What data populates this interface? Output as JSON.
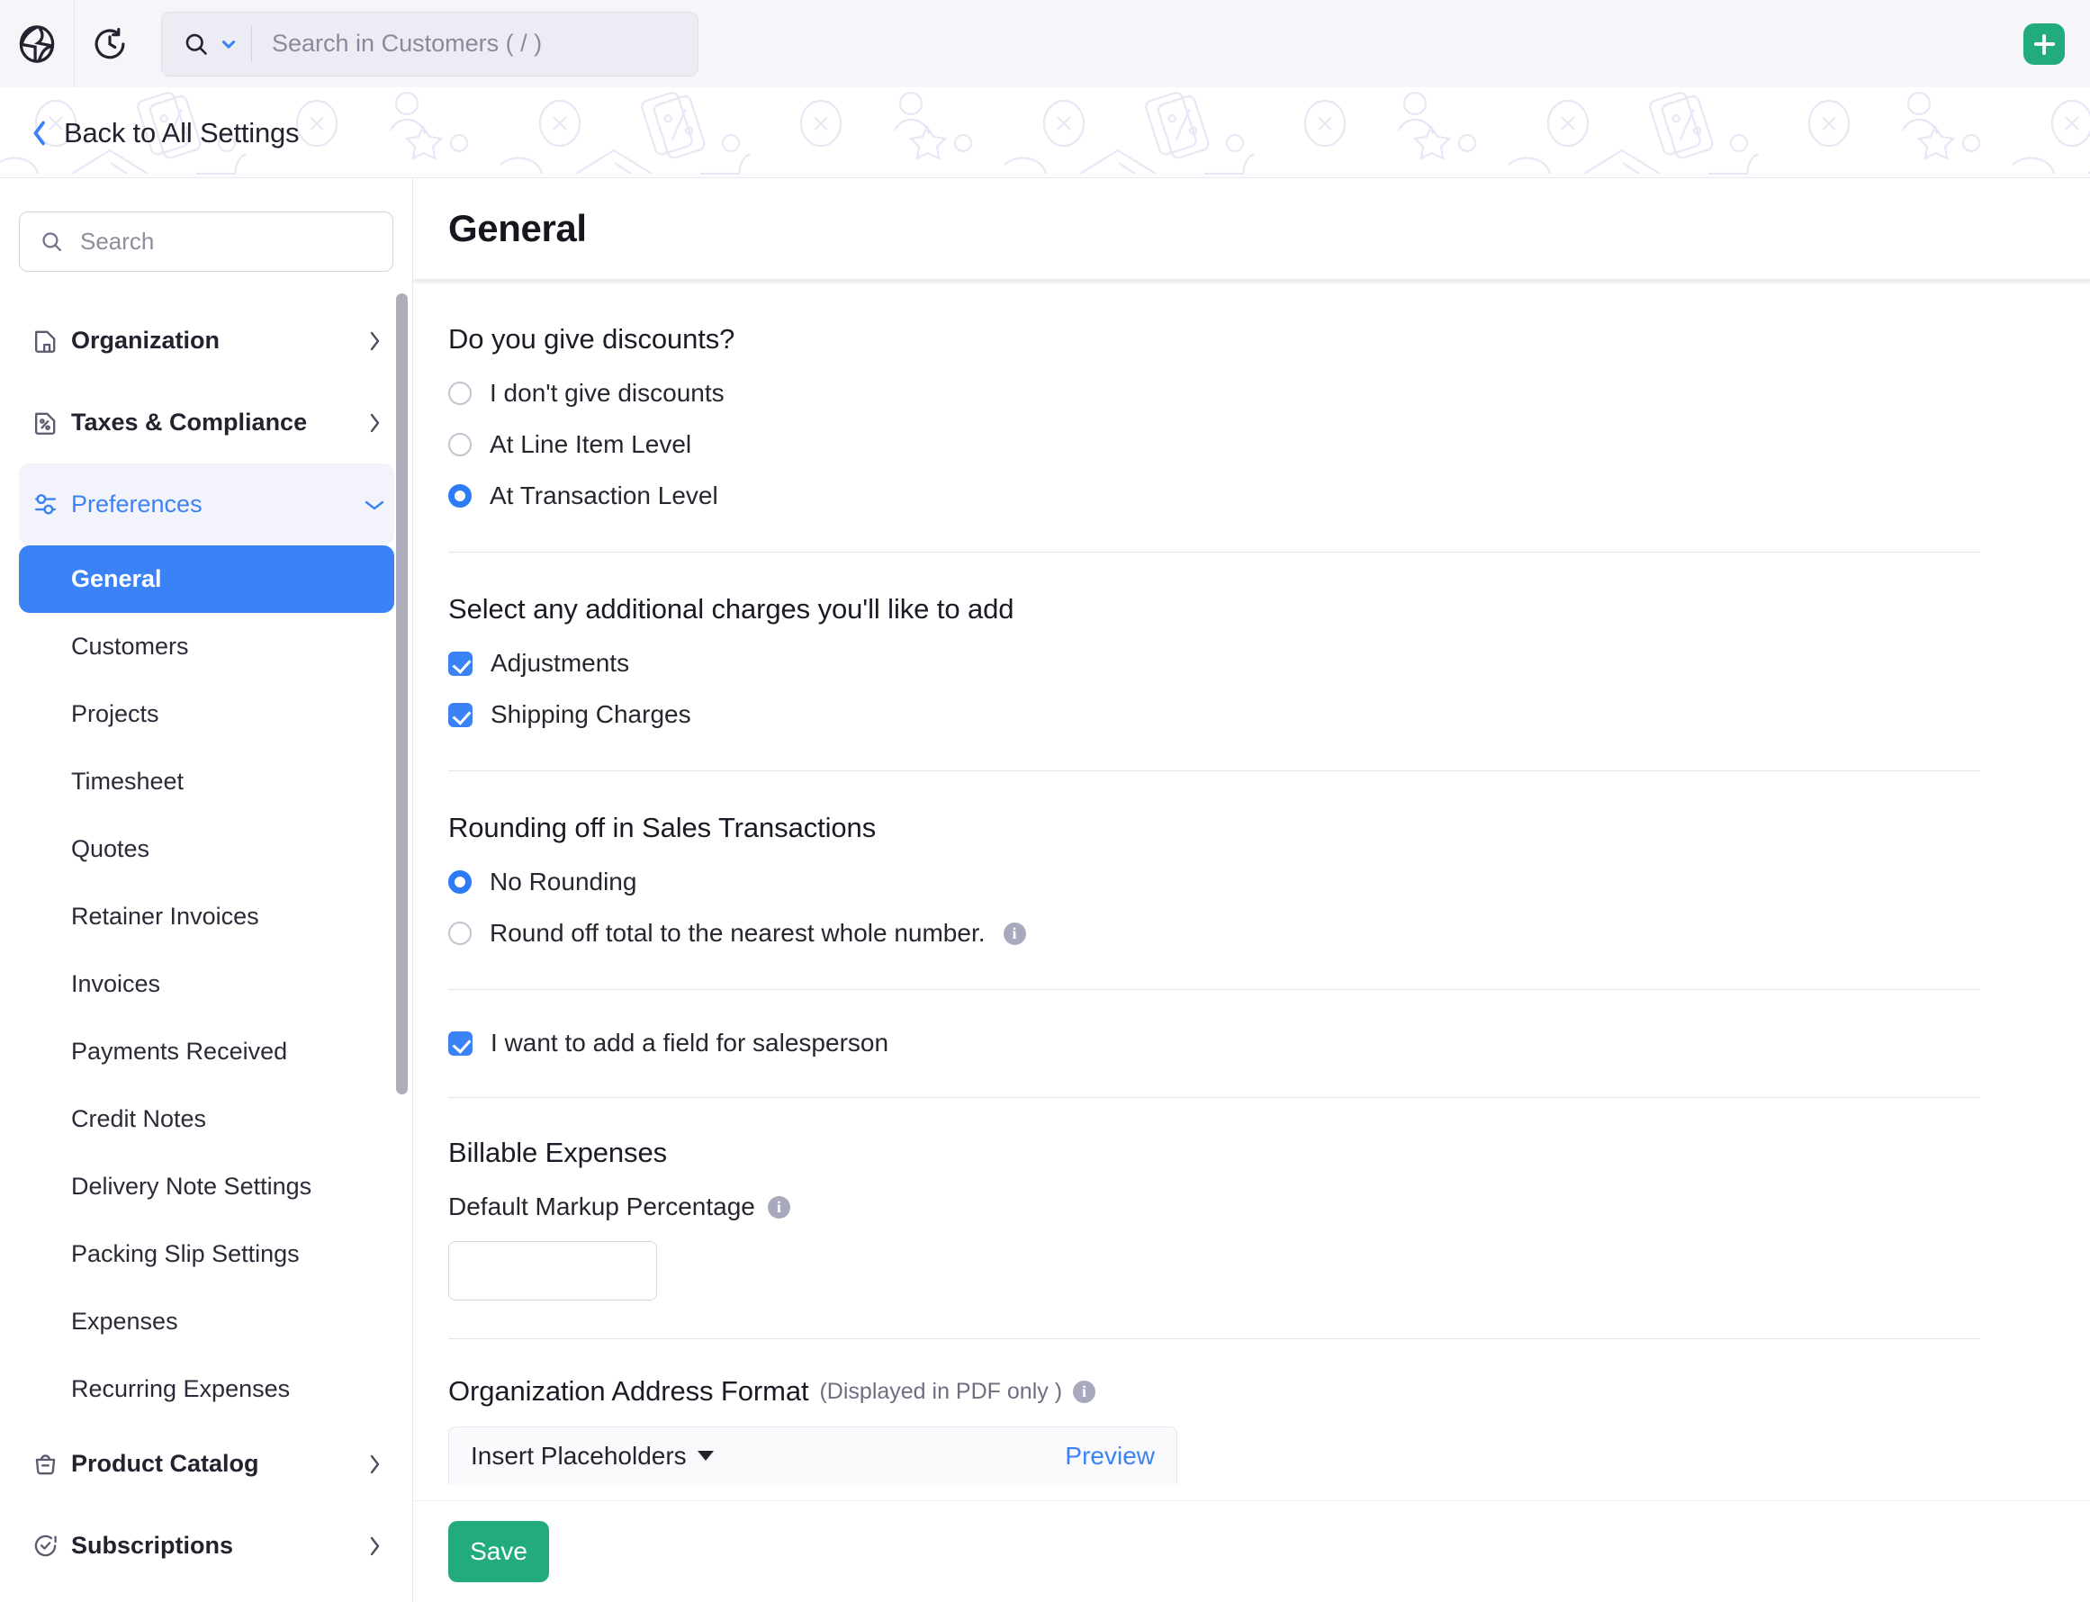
{
  "colors": {
    "accent_blue": "#3b82f6",
    "accent_green": "#22ab7d",
    "topbar_bg": "#f5f5fa",
    "text_dark": "#23232f",
    "info_gray": "#a9a9bd"
  },
  "topbar": {
    "logo_icon": "globe-bolt-logo-icon",
    "recent_icon": "clock-history-icon",
    "search": {
      "magnifier_icon": "search-icon",
      "scope_chevron_icon": "chevron-down-icon",
      "placeholder": "Search in Customers ( / )",
      "value": ""
    },
    "add_button_icon": "plus-icon"
  },
  "breadcrumb": {
    "back_icon": "chevron-left-icon",
    "label": "Back to All Settings"
  },
  "sidebar": {
    "search": {
      "icon": "search-icon",
      "placeholder": "Search",
      "value": ""
    },
    "groups": [
      {
        "label": "Organization",
        "icon": "organization-doc-icon",
        "chevron": "chevron-right-icon",
        "expanded": false
      },
      {
        "label": "Taxes & Compliance",
        "icon": "tax-percent-doc-icon",
        "chevron": "chevron-right-icon",
        "expanded": false
      },
      {
        "label": "Preferences",
        "icon": "preferences-sliders-icon",
        "chevron": "chevron-down-icon",
        "expanded": true
      }
    ],
    "preferences_items": [
      {
        "label": "General",
        "selected": true
      },
      {
        "label": "Customers",
        "selected": false
      },
      {
        "label": "Projects",
        "selected": false
      },
      {
        "label": "Timesheet",
        "selected": false
      },
      {
        "label": "Quotes",
        "selected": false
      },
      {
        "label": "Retainer Invoices",
        "selected": false
      },
      {
        "label": "Invoices",
        "selected": false
      },
      {
        "label": "Payments Received",
        "selected": false
      },
      {
        "label": "Credit Notes",
        "selected": false
      },
      {
        "label": "Delivery Note Settings",
        "selected": false
      },
      {
        "label": "Packing Slip Settings",
        "selected": false
      },
      {
        "label": "Expenses",
        "selected": false
      },
      {
        "label": "Recurring Expenses",
        "selected": false
      }
    ],
    "bottom_groups": [
      {
        "label": "Product Catalog",
        "icon": "shopping-bag-icon",
        "chevron": "chevron-right-icon"
      },
      {
        "label": "Subscriptions",
        "icon": "subscription-refresh-check-icon",
        "chevron": "chevron-right-icon"
      }
    ]
  },
  "main": {
    "page_title": "General",
    "sections": {
      "discounts": {
        "title": "Do you give discounts?",
        "options": [
          {
            "label": "I don't give discounts",
            "selected": false
          },
          {
            "label": "At Line Item Level",
            "selected": false
          },
          {
            "label": "At Transaction Level",
            "selected": true
          }
        ]
      },
      "additional_charges": {
        "title": "Select any additional charges you'll like to add",
        "options": [
          {
            "label": "Adjustments",
            "checked": true
          },
          {
            "label": "Shipping Charges",
            "checked": true
          }
        ]
      },
      "rounding": {
        "title": "Rounding off in Sales Transactions",
        "options": [
          {
            "label": "No Rounding",
            "selected": true,
            "info": false
          },
          {
            "label": "Round off total to the nearest whole number.",
            "selected": false,
            "info": true
          }
        ]
      },
      "salesperson": {
        "label": "I want to add a field for salesperson",
        "checked": true
      },
      "billable_expenses": {
        "title": "Billable Expenses",
        "field_label": "Default Markup Percentage",
        "field_info_icon": "info-icon",
        "value": "",
        "suffix": "%"
      },
      "address_format": {
        "title": "Organization Address Format",
        "note": "(Displayed in PDF only )",
        "info_icon": "info-icon",
        "insert_placeholders_label": "Insert Placeholders",
        "insert_placeholders_caret": "caret-down-icon",
        "preview_label": "Preview"
      }
    }
  },
  "footer": {
    "save_label": "Save"
  }
}
